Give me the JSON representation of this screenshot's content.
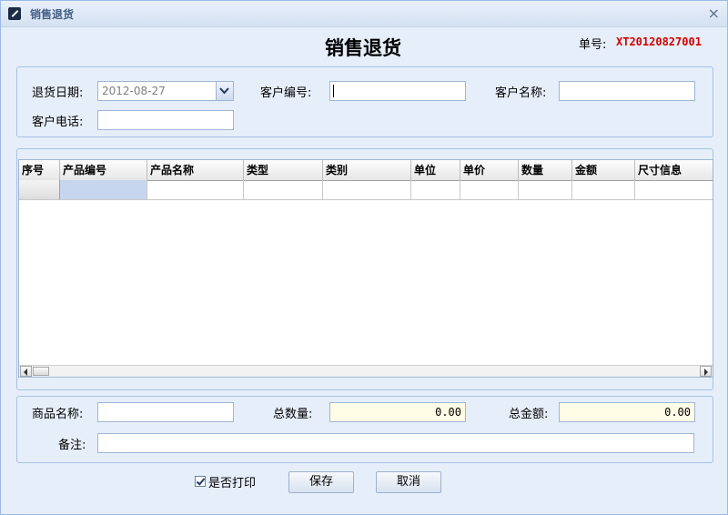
{
  "window": {
    "title": "销售退货",
    "icon": "app-icon"
  },
  "form": {
    "title": "销售退货",
    "order_no_label": "单号:",
    "order_no": "XT20120827001"
  },
  "header_fields": {
    "return_date_label": "退货日期:",
    "return_date_value": "2012-08-27",
    "customer_no_label": "客户编号:",
    "customer_no_value": "",
    "customer_name_label": "客户名称:",
    "customer_name_value": "",
    "customer_phone_label": "客户电话:",
    "customer_phone_value": ""
  },
  "grid": {
    "columns": [
      "序号",
      "产品编号",
      "产品名称",
      "类型",
      "类别",
      "单位",
      "单价",
      "数量",
      "金额",
      "尺寸信息"
    ],
    "rows": [
      [
        "",
        "",
        "",
        "",
        "",
        "",
        "",
        "",
        "",
        ""
      ]
    ]
  },
  "footer_fields": {
    "product_name_label": "商品名称:",
    "product_name_value": "",
    "total_qty_label": "总数量:",
    "total_qty_value": "0.00",
    "total_amount_label": "总金额:",
    "total_amount_value": "0.00",
    "remark_label": "备注:",
    "remark_value": ""
  },
  "actions": {
    "print_label": "是否打印",
    "print_checked": true,
    "save_label": "保存",
    "cancel_label": "取消"
  },
  "colors": {
    "order_no": "#d20000",
    "selected_cell": "#c6d6ef",
    "total_bg": "#fffde6"
  }
}
